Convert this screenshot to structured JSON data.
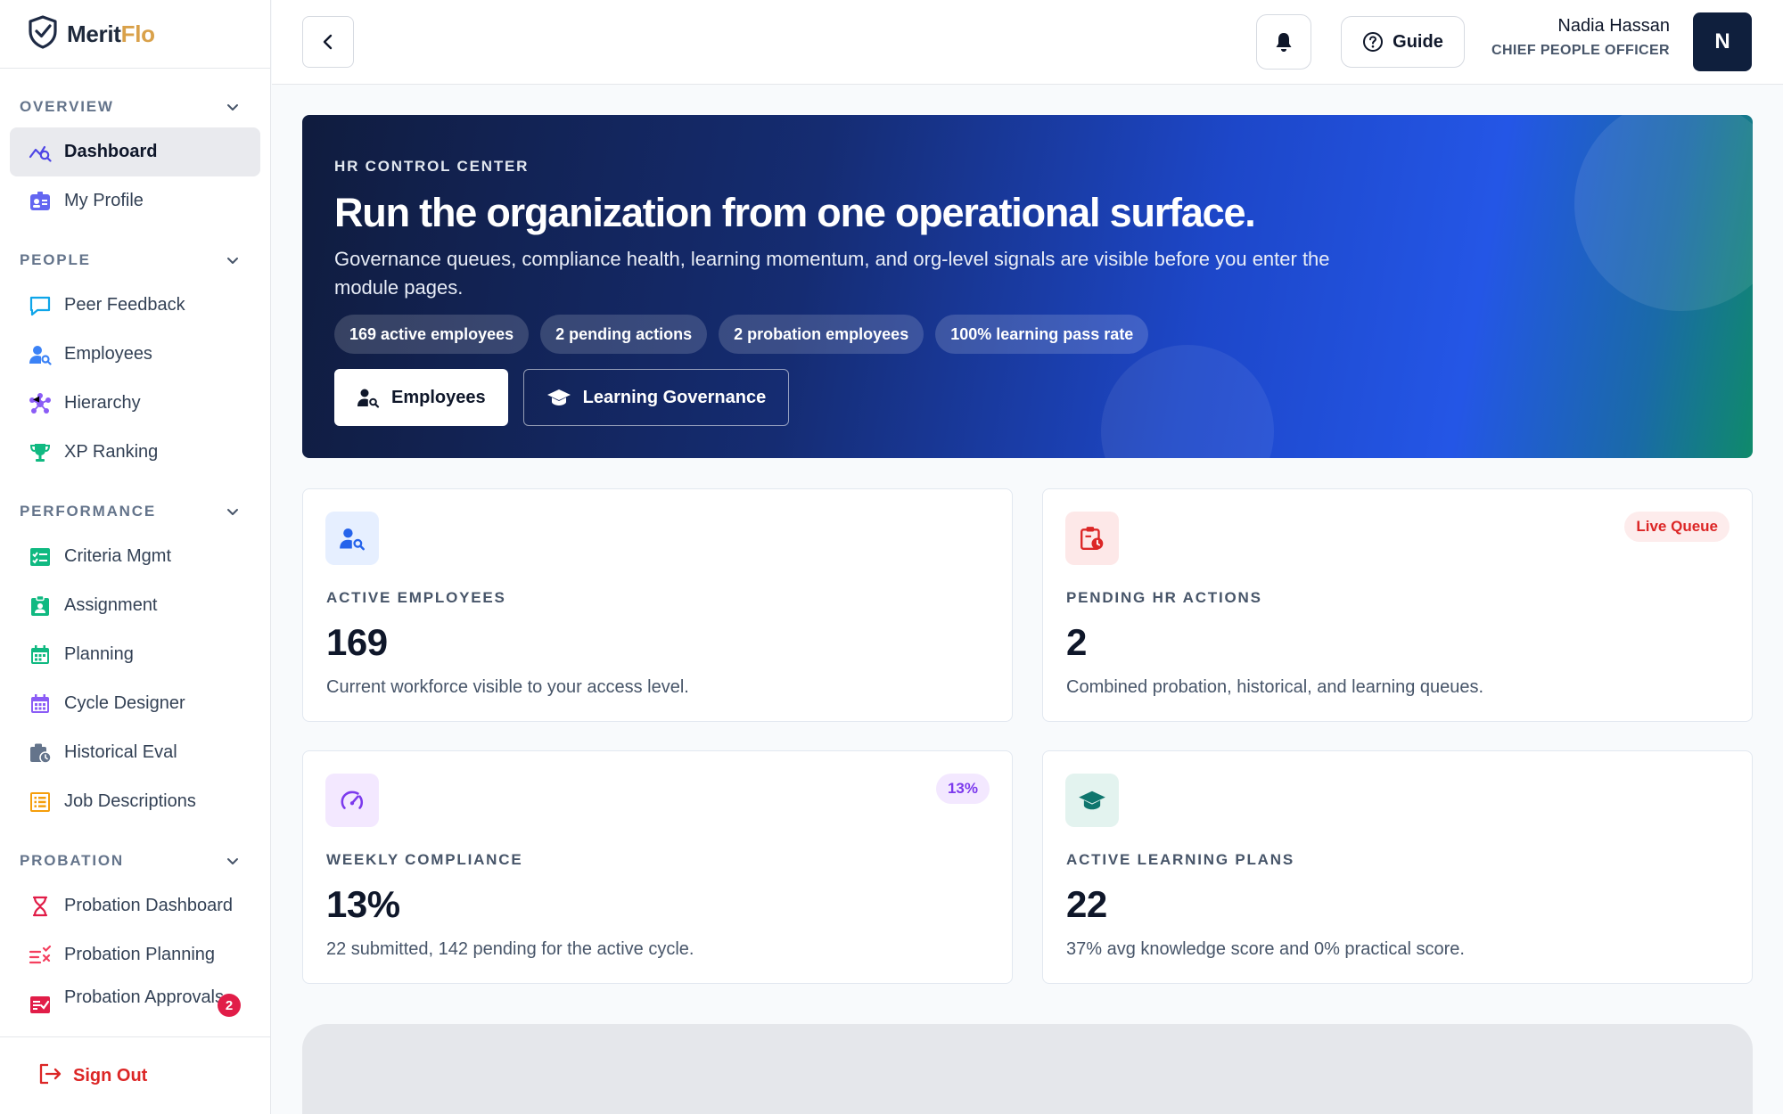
{
  "brand": {
    "name_part1": "Merit",
    "name_part2": "Flo"
  },
  "sidebar": {
    "sections": [
      {
        "label": "OVERVIEW",
        "items": [
          {
            "label": "Dashboard",
            "icon": "dashboard-icon",
            "active": true
          },
          {
            "label": "My Profile",
            "icon": "profile-icon"
          }
        ]
      },
      {
        "label": "PEOPLE",
        "items": [
          {
            "label": "Peer Feedback",
            "icon": "chat-icon"
          },
          {
            "label": "Employees",
            "icon": "user-search-icon"
          },
          {
            "label": "Hierarchy",
            "icon": "hierarchy-icon"
          },
          {
            "label": "XP Ranking",
            "icon": "trophy-icon"
          }
        ]
      },
      {
        "label": "PERFORMANCE",
        "items": [
          {
            "label": "Criteria Mgmt",
            "icon": "checklist-icon"
          },
          {
            "label": "Assignment",
            "icon": "assignment-icon"
          },
          {
            "label": "Planning",
            "icon": "calendar-icon"
          },
          {
            "label": "Cycle Designer",
            "icon": "calendar-grid-icon"
          },
          {
            "label": "Historical Eval",
            "icon": "history-icon"
          },
          {
            "label": "Job Descriptions",
            "icon": "list-icon"
          }
        ]
      },
      {
        "label": "PROBATION",
        "items": [
          {
            "label": "Probation Dashboard",
            "icon": "hourglass-icon"
          },
          {
            "label": "Probation Planning",
            "icon": "planning-icon"
          },
          {
            "label": "Probation Approvals",
            "icon": "approval-icon",
            "badge": "2"
          }
        ]
      }
    ],
    "signout_label": "Sign Out"
  },
  "topbar": {
    "guide_label": "Guide",
    "user_name": "Nadia Hassan",
    "user_role": "CHIEF PEOPLE OFFICER",
    "avatar_initial": "N"
  },
  "hero": {
    "eyebrow": "HR CONTROL CENTER",
    "title": "Run the organization from one operational surface.",
    "subtitle": "Governance queues, compliance health, learning momentum, and org-level signals are visible before you enter the module pages.",
    "chips": [
      "169 active employees",
      "2 pending actions",
      "2 probation employees",
      "100% learning pass rate"
    ],
    "primary_button": "Employees",
    "secondary_button": "Learning Governance"
  },
  "cards": [
    {
      "label": "ACTIVE EMPLOYEES",
      "value": "169",
      "description": "Current workforce visible to your access level.",
      "icon": "user-search-icon",
      "tag": ""
    },
    {
      "label": "PENDING HR ACTIONS",
      "value": "2",
      "description": "Combined probation, historical, and learning queues.",
      "icon": "clipboard-clock-icon",
      "tag": "Live Queue"
    },
    {
      "label": "WEEKLY COMPLIANCE",
      "value": "13%",
      "description": "22 submitted, 142 pending for the active cycle.",
      "icon": "gauge-icon",
      "tag": "13%"
    },
    {
      "label": "ACTIVE LEARNING PLANS",
      "value": "22",
      "description": "37% avg knowledge score and 0% practical score.",
      "icon": "graduation-cap-icon",
      "tag": ""
    }
  ],
  "colors": {
    "accent_navy": "#0f1f3d",
    "danger": "#dc2626",
    "compliance_purple": "#7c3aed",
    "learning_teal": "#0f766e"
  }
}
